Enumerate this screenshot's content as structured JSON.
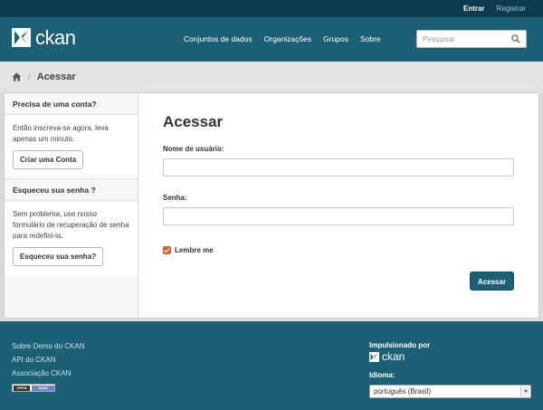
{
  "account": {
    "login": "Entrar",
    "register": "Registrar"
  },
  "brand": {
    "name": "ckan"
  },
  "nav": {
    "datasets": "Conjuntos de dados",
    "organizations": "Organizações",
    "groups": "Grupos",
    "about": "Sobre"
  },
  "search": {
    "placeholder": "Pesquisar"
  },
  "breadcrumb": {
    "current": "Acessar"
  },
  "sidebar": {
    "register": {
      "heading": "Precisa de uma conta?",
      "text": "Então inscreva-se agora, leva apenas um minuto.",
      "button": "Criar uma Conta"
    },
    "forgot": {
      "heading": "Esqueceu sua senha ?",
      "text": "Sem problema, use nosso formulário de recuperação de senha para redefini-la.",
      "button": "Esqueceu sua senha?"
    }
  },
  "form": {
    "heading": "Acessar",
    "username_label": "Nome de usuário:",
    "username_value": "",
    "password_label": "Senha:",
    "password_value": "",
    "remember_label": "Lembre me",
    "remember_checked": true,
    "submit": "Acessar"
  },
  "footer": {
    "links": [
      "Sobre Demo do CKAN",
      "API do CKAN",
      "Associação CKAN"
    ],
    "badge": {
      "left": "OPEN",
      "right": "DATA"
    },
    "powered_by": "Impulsionado por",
    "powered_logo": "ckan",
    "language_label": "Idioma:",
    "language_value": "português (Brasil)"
  },
  "colors": {
    "masthead": "#1d5f74",
    "account_bar": "#0e3b4c",
    "accent": "#c76b3d"
  }
}
